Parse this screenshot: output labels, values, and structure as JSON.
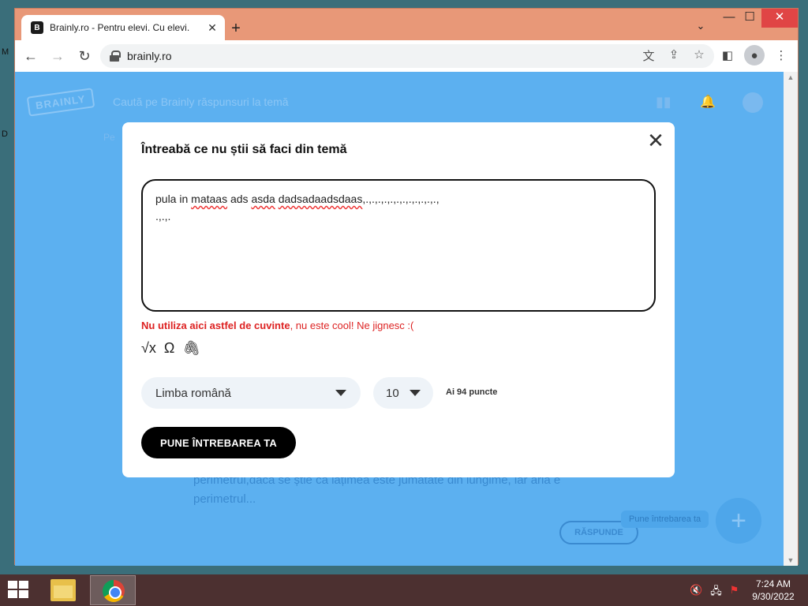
{
  "desktop": {
    "glyph_top": "M",
    "glyph_mid": "D"
  },
  "browser": {
    "tab_title": "Brainly.ro - Pentru elevi. Cu elevi.",
    "tab_favicon": "B",
    "tab_close": "✕",
    "new_tab": "+",
    "tab_dropdown": "⌄",
    "win_min": "—",
    "win_max": "☐",
    "win_close": "✕",
    "back": "←",
    "forward": "→",
    "reload": "↻",
    "url": "brainly.ro",
    "translate_icon": "文",
    "share_icon": "⇪",
    "bookmark_icon": "☆",
    "sidebar_icon": "◧",
    "menu_icon": "⋮",
    "profile_icon": "●"
  },
  "background_page": {
    "logo": "BRAINLY",
    "search_placeholder": "Caută pe Brainly răspunsuri la temă",
    "stats_icon": "▮▮",
    "bell_icon": "🔔",
    "side_hint": "Pe",
    "question_text_line1": "perimetrul,dacă se știe că lățimea este jumătate din lungime, iar aria e",
    "question_text_line2": "perimetrul...",
    "answer_button": "RĂSPUNDE",
    "ask_pill": "Pune întrebarea ta",
    "fab": "+"
  },
  "modal": {
    "title": "Întreabă ce nu știi să faci din temă",
    "close": "✕",
    "text_line1_a": "pula in ",
    "text_line1_b": "mataas",
    "text_line1_c": " ads ",
    "text_line1_d": "asda",
    "text_line1_e": " ",
    "text_line1_f": "dadsadaadsdaas",
    "text_line1_g": ",.,.,.,.,.,.,.,.,.,.,.,.,",
    "text_line2": ".,.,.",
    "error_bold": "Nu utiliza aici astfel de cuvinte",
    "error_rest": ", nu este cool! Ne jignesc :(",
    "tool_math": "√x",
    "tool_omega": "Ω",
    "tool_attach": "🖇",
    "language": "Limba română",
    "points": "10",
    "have_points": "Ai 94 puncte",
    "submit": "PUNE ÎNTREBAREA TA"
  },
  "taskbar": {
    "time": "7:24 AM",
    "date": "9/30/2022",
    "volume_icon": "🔇",
    "network_icon": "🖧",
    "flag_icon": "⚑"
  }
}
